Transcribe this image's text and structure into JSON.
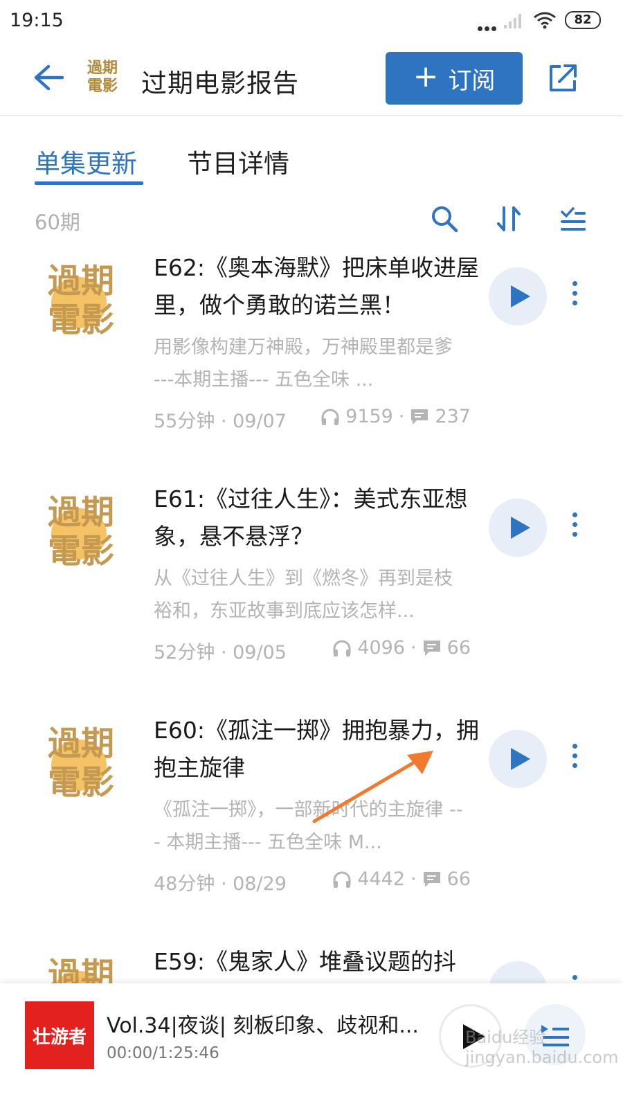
{
  "status_bar": {
    "time": "19:15",
    "battery": "82"
  },
  "header": {
    "title": "过期电影报告",
    "subscribe_label": "订阅",
    "logo_text": "過期\n電影"
  },
  "tabs": [
    {
      "label": "单集更新"
    },
    {
      "label": "节目详情"
    }
  ],
  "list": {
    "count": "60期"
  },
  "thumb_text": {
    "line1": "過期",
    "line2": "電影"
  },
  "episodes": [
    {
      "title": "E62:《奥本海默》把床单收进屋里，做个勇敢的诺兰黑！",
      "desc": "用影像构建万神殿，万神殿里都是爹 ---本期主播--- 五色全味 ...",
      "duration_date": "55分钟 · 09/07",
      "plays": "9159",
      "comments": "237"
    },
    {
      "title": "E61:《过往人生》：美式东亚想象，悬不悬浮？",
      "desc": "从《过往人生》到《燃冬》再到是枝裕和，东亚故事到底应该怎样...",
      "duration_date": "52分钟 · 09/05",
      "plays": "4096",
      "comments": "66"
    },
    {
      "title": "E60:《孤注一掷》拥抱暴力，拥抱主旋律",
      "desc": "《孤注一掷》，一部新时代的主旋律 --- 本期主播--- 五色全味 M...",
      "duration_date": "48分钟 · 08/29",
      "plays": "4442",
      "comments": "66"
    },
    {
      "title": "E59:《鬼家人》堆叠议题的抖",
      "desc": "",
      "duration_date": "",
      "plays": "",
      "comments": ""
    }
  ],
  "player": {
    "cover_text": "壮游者",
    "title": "Vol.34|夜谈| 刻板印象、歧视和...",
    "time": "00:00/1:25:46"
  },
  "watermark": "Baidu经验 jingyan.baidu.com",
  "colors": {
    "accent": "#2f74c0",
    "arrow": "#f07a30",
    "player_cover": "#e3211f"
  }
}
